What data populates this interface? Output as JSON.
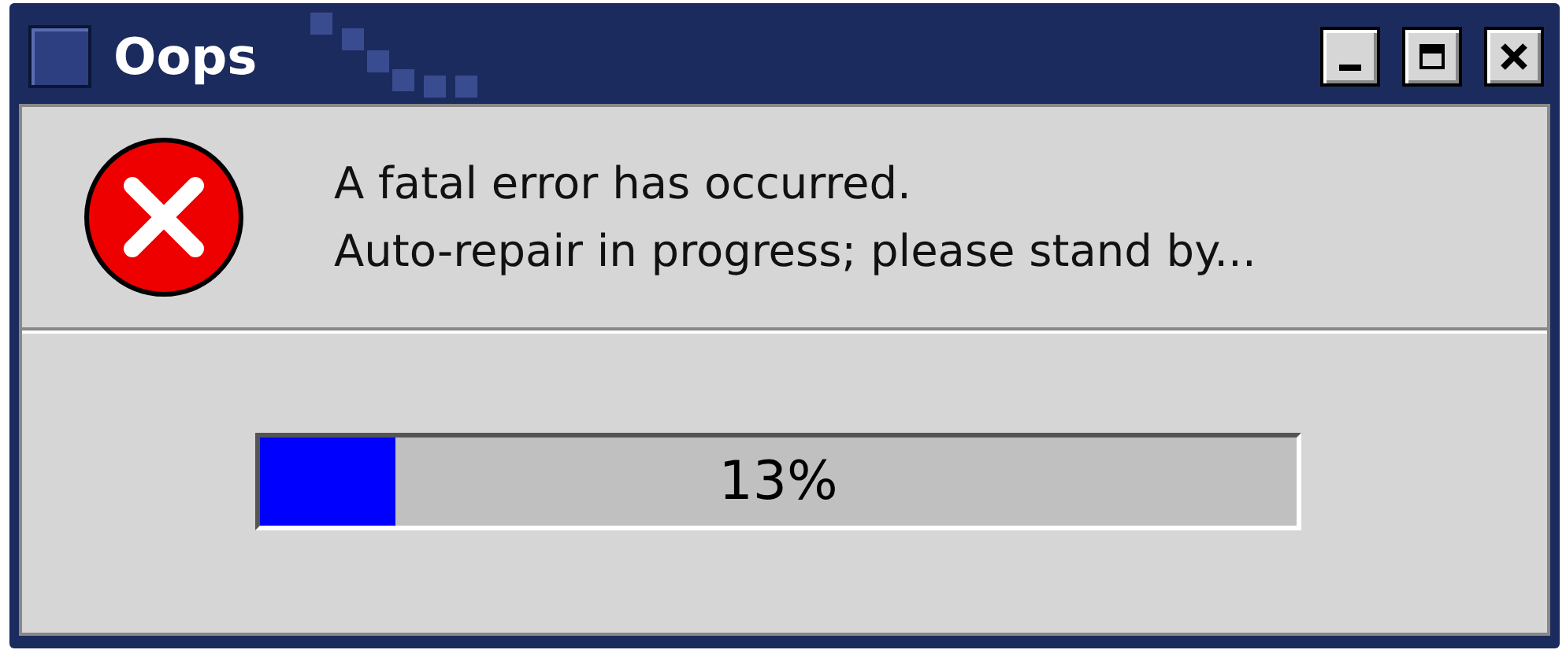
{
  "window": {
    "title": "Oops"
  },
  "message": {
    "lines": [
      "A fatal error has occurred.",
      "Auto-repair in progress; please stand by..."
    ]
  },
  "progress": {
    "level": 0.13,
    "reading": "13%"
  }
}
